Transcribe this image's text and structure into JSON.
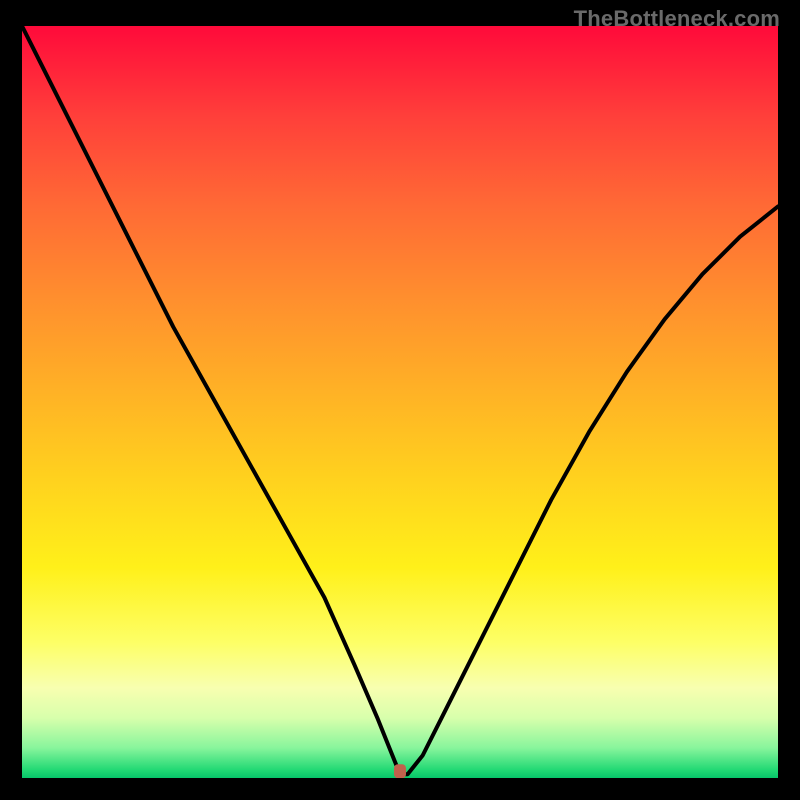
{
  "watermark": "TheBottleneck.com",
  "chart_data": {
    "type": "line",
    "title": "",
    "xlabel": "",
    "ylabel": "",
    "xlim": [
      0,
      100
    ],
    "ylim": [
      0,
      100
    ],
    "grid": false,
    "legend": false,
    "series": [
      {
        "name": "bottleneck-curve",
        "x": [
          0,
          5,
          10,
          15,
          20,
          25,
          30,
          35,
          40,
          44,
          47,
          49,
          50,
          51,
          53,
          56,
          60,
          65,
          70,
          75,
          80,
          85,
          90,
          95,
          100
        ],
        "y": [
          100,
          90,
          80,
          70,
          60,
          51,
          42,
          33,
          24,
          15,
          8,
          3,
          0.5,
          0.5,
          3,
          9,
          17,
          27,
          37,
          46,
          54,
          61,
          67,
          72,
          76
        ]
      }
    ],
    "marker": {
      "x": 50,
      "y": 0.5,
      "name": "minimum"
    },
    "background_gradient": {
      "top": "#ff0a3a",
      "mid": "#ffe117",
      "bottom": "#07c56a"
    }
  }
}
